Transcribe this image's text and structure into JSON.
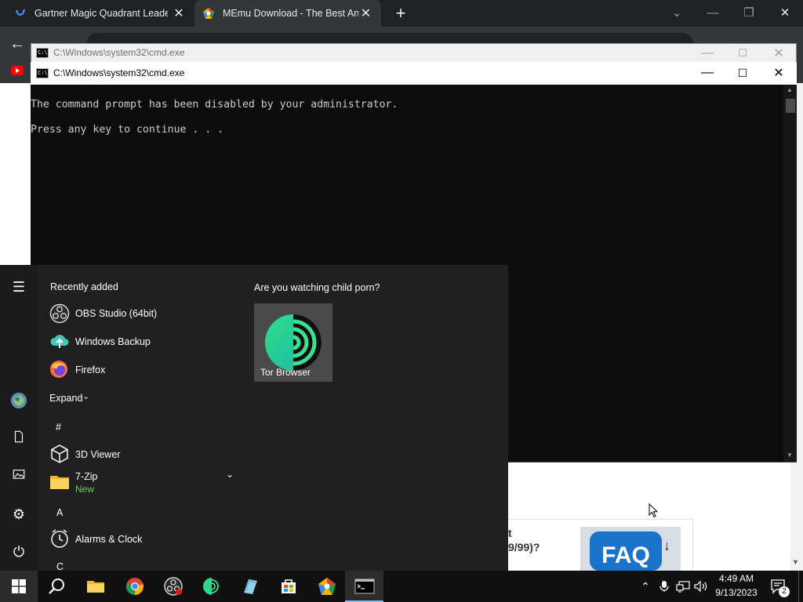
{
  "browser": {
    "tabs": [
      {
        "title": "Gartner Magic Quadrant Leader"
      },
      {
        "title": "MEmu Download - The Best And"
      }
    ],
    "new_tab_glyph": "+"
  },
  "webpage": {
    "question_fragment": "t",
    "question_fragment2": "9/99)?",
    "faq_label": "FAQ"
  },
  "cmd_back": {
    "title": "C:\\Windows\\system32\\cmd.exe"
  },
  "cmd_front": {
    "title": "C:\\Windows\\system32\\cmd.exe",
    "lines": [
      "The command prompt has been disabled by your administrator.",
      "Press any key to continue . . ."
    ]
  },
  "start_menu": {
    "recently_added_header": "Recently added",
    "recent": [
      {
        "label": "OBS Studio (64bit)",
        "icon": "obs-icon"
      },
      {
        "label": "Windows Backup",
        "icon": "cloud-backup-icon"
      },
      {
        "label": "Firefox",
        "icon": "firefox-icon"
      }
    ],
    "expand_label": "Expand",
    "groups": [
      {
        "letter": "#"
      },
      {
        "letter": "A"
      },
      {
        "letter": "C"
      }
    ],
    "apps": [
      {
        "label": "3D Viewer",
        "icon": "3d-viewer-icon"
      },
      {
        "label": "7-Zip",
        "sub": "New",
        "icon": "folder-icon"
      },
      {
        "label": "Alarms & Clock",
        "icon": "clock-icon"
      }
    ],
    "tile_group_title": "Are you watching child porn?",
    "tile": {
      "label": "Tor Browser",
      "icon": "tor-browser-icon"
    }
  },
  "taskbar": {
    "time": "4:49 AM",
    "date": "9/13/2023",
    "notification_count": "2"
  },
  "colors": {
    "chrome_dark": "#202124",
    "chrome_tab_active": "#35363a",
    "start_bg": "#202020",
    "taskbar_bg": "#101010",
    "new_badge": "#6ccb5f",
    "accent": "#76b9ed"
  }
}
